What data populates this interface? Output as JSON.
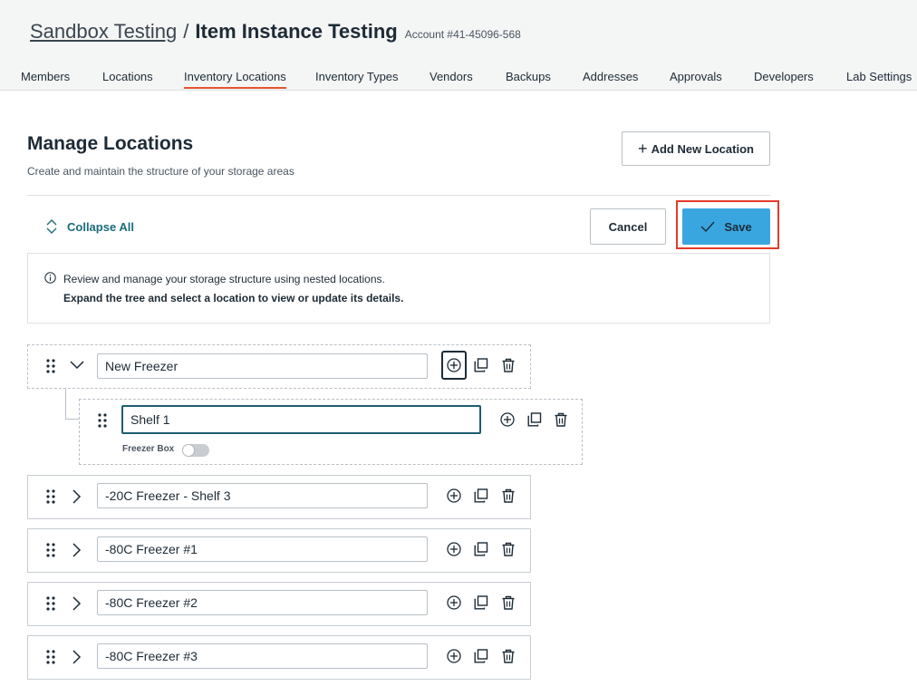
{
  "breadcrumb": {
    "parent": "Sandbox Testing",
    "separator": "/",
    "current": "Item Instance Testing",
    "account": "Account #41-45096-568"
  },
  "tabs": [
    {
      "label": "Members"
    },
    {
      "label": "Locations"
    },
    {
      "label": "Inventory Locations",
      "active": true
    },
    {
      "label": "Inventory Types"
    },
    {
      "label": "Vendors"
    },
    {
      "label": "Backups"
    },
    {
      "label": "Addresses"
    },
    {
      "label": "Approvals"
    },
    {
      "label": "Developers"
    },
    {
      "label": "Lab Settings"
    }
  ],
  "page": {
    "title": "Manage Locations",
    "subtitle": "Create and maintain the structure of your storage areas",
    "add_button": "Add New Location",
    "collapse_all": "Collapse All",
    "cancel": "Cancel",
    "save": "Save"
  },
  "info": {
    "line1": "Review and manage your storage structure using nested locations.",
    "line2": "Expand the tree and select a location to view or update its details."
  },
  "locations": [
    {
      "name": "New Freezer",
      "expanded": true,
      "children": [
        {
          "name": "Shelf 1",
          "toggle_label": "Freezer Box",
          "toggle_on": false
        }
      ]
    },
    {
      "name": "-20C Freezer - Shelf 3",
      "expanded": false
    },
    {
      "name": "-80C Freezer #1",
      "expanded": false
    },
    {
      "name": "-80C Freezer #2",
      "expanded": false
    },
    {
      "name": "-80C Freezer #3",
      "expanded": false
    }
  ],
  "colors": {
    "accent_tab": "#e4552c",
    "save_bg": "#3aa6e0",
    "link": "#1a6c7a",
    "highlight": "#e53a2a"
  }
}
